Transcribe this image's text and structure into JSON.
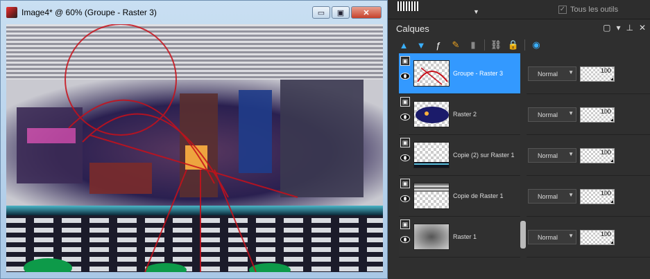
{
  "image_window": {
    "title": "Image4* @  60% (Groupe - Raster 3)",
    "buttons": {
      "minimize": "▭",
      "maximize": "▣",
      "close": "✕"
    }
  },
  "top_strip": {
    "all_tools_label": "Tous les outils"
  },
  "layers_panel": {
    "title": "Calques",
    "header_buttons": {
      "menu": "▢",
      "dropdown": "▾",
      "pin": "⊥",
      "close": "✕"
    },
    "layers": [
      {
        "name": "Groupe - Raster 3",
        "blend": "Normal",
        "opacity": "100",
        "selected": true
      },
      {
        "name": "Raster 2",
        "blend": "Normal",
        "opacity": "100",
        "selected": false
      },
      {
        "name": "Copie (2) sur Raster 1",
        "blend": "Normal",
        "opacity": "100",
        "selected": false
      },
      {
        "name": "Copie de Raster 1",
        "blend": "Normal",
        "opacity": "100",
        "selected": false
      },
      {
        "name": "Raster 1",
        "blend": "Normal",
        "opacity": "100",
        "selected": false
      }
    ]
  },
  "colors": {
    "selection": "#3399ff",
    "panel_bg": "#2f2f2f",
    "titlebar": "#b8d3ec"
  }
}
